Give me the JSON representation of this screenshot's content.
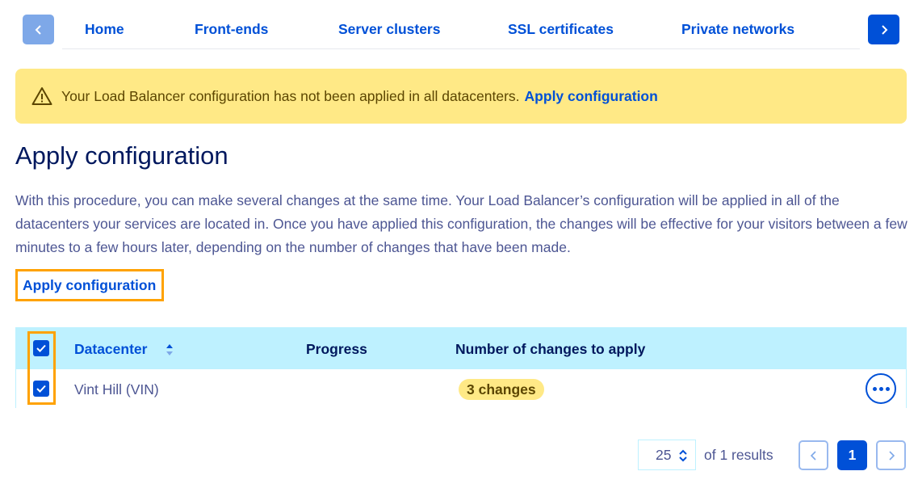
{
  "nav": {
    "tabs": [
      {
        "label": "Home"
      },
      {
        "label": "Front-ends"
      },
      {
        "label": "Server clusters"
      },
      {
        "label": "SSL certificates"
      },
      {
        "label": "Private networks"
      }
    ],
    "prev_icon": "chevron-left-icon",
    "next_icon": "chevron-right-icon"
  },
  "banner": {
    "icon": "warning-icon",
    "message": "Your Load Balancer configuration has not been applied in all datacenters.",
    "link": "Apply configuration"
  },
  "page": {
    "title": "Apply configuration",
    "description": "With this procedure, you can make several changes at the same time. Your Load Balancer’s configuration will be applied in all of the datacenters your services are located in. Once you have applied this configuration, the changes will be effective for your visitors between a few minutes to a few hours later, depending on the number of changes that have been made.",
    "apply_button": "Apply configuration"
  },
  "table": {
    "columns": {
      "datacenter": "Datacenter",
      "progress": "Progress",
      "changes": "Number of changes to apply"
    },
    "header_checkbox_checked": true,
    "rows": [
      {
        "checked": true,
        "datacenter": "Vint Hill (VIN)",
        "progress": "",
        "changes": "3 changes"
      }
    ]
  },
  "pagination": {
    "per_page": "25",
    "results": "of 1 results",
    "current_page": "1"
  },
  "colors": {
    "accent": "#0050d7",
    "warning_bg": "#ffe986",
    "table_header_bg": "#bef1ff",
    "highlight": "#ffa200"
  }
}
